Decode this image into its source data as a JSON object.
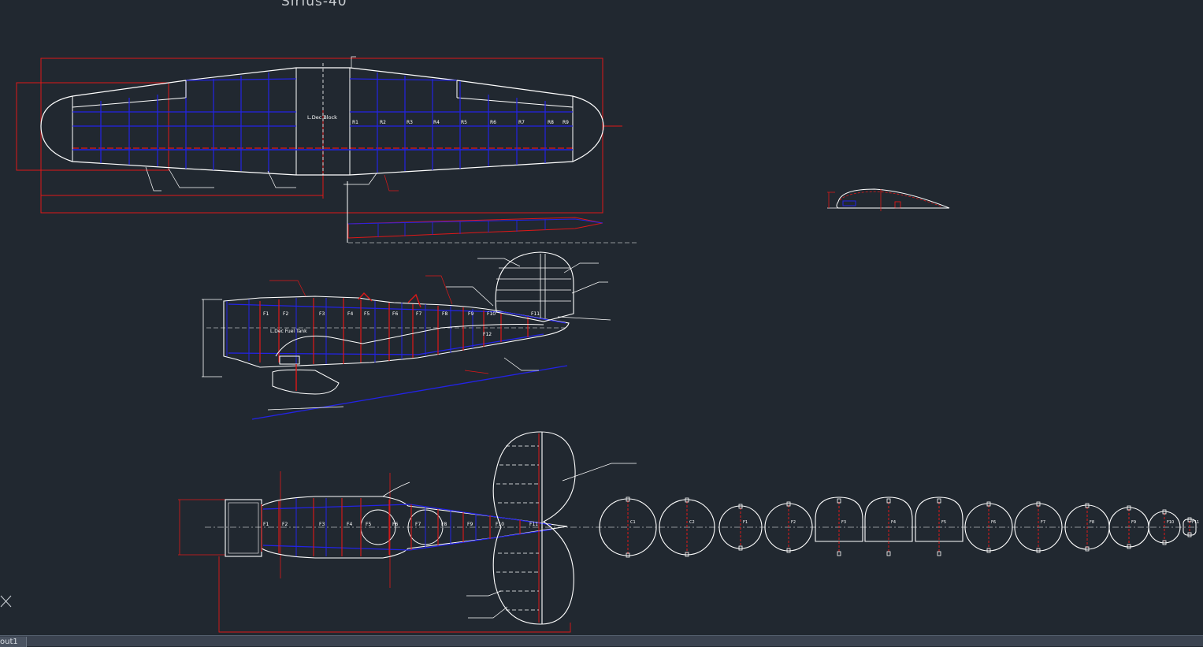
{
  "drawing_title": "Sirius-40",
  "layout_tab": "out1",
  "colors": {
    "background": "#212830",
    "outline": "#ffffff",
    "structure": "#2323e6",
    "dimension": "#e01818"
  },
  "wing": {
    "block_label": "L.Dec Block",
    "ribs": [
      "R1",
      "R2",
      "R3",
      "R4",
      "R5",
      "R6",
      "R7",
      "R8",
      "R9"
    ]
  },
  "fuselage_side": {
    "tank_label": "L.Dec Fuel Tank",
    "formers": [
      "F1",
      "F2",
      "F3",
      "F4",
      "F5",
      "F6",
      "F7",
      "F8",
      "F9",
      "F10",
      "F11"
    ],
    "lower_former": "F12"
  },
  "fuselage_top": {
    "formers": [
      "F1",
      "F2",
      "F3",
      "F4",
      "F5",
      "F6",
      "F7",
      "F8",
      "F9",
      "F10",
      "F11"
    ]
  },
  "former_templates": [
    "C1",
    "C2",
    "F1",
    "F2",
    "F3",
    "F4",
    "F5",
    "F6",
    "F7",
    "F8",
    "F9",
    "F10",
    "F11"
  ],
  "icons": {
    "ucs": "ucs-icon"
  }
}
